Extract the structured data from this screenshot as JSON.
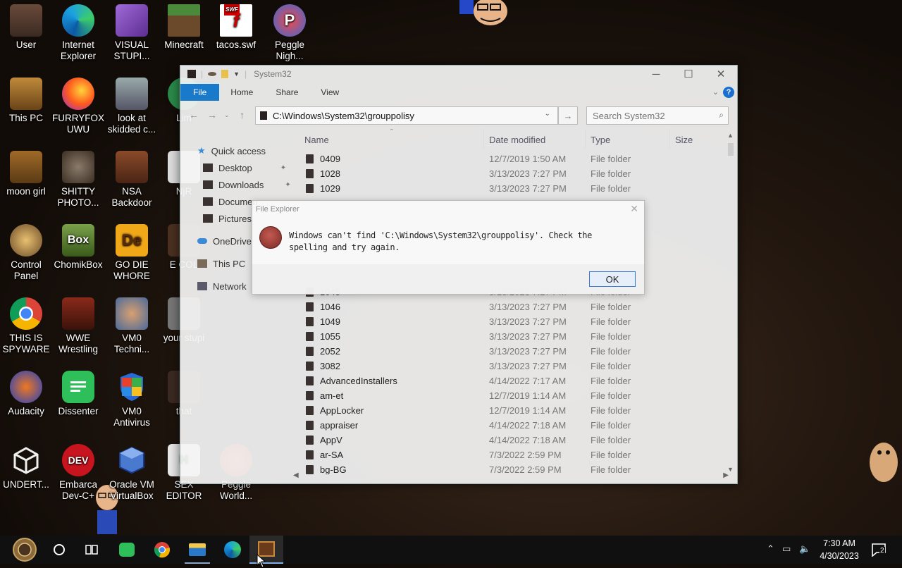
{
  "desktop": {
    "icons": [
      {
        "label": "User"
      },
      {
        "label": "Internet Explorer"
      },
      {
        "label": "VISUAL STUPI..."
      },
      {
        "label": "Minecraft"
      },
      {
        "label": "tacos.swf",
        "badge": "SWF"
      },
      {
        "label": "Peggle Nigh..."
      },
      {
        "label": "This PC"
      },
      {
        "label": "FURRYFOX UWU"
      },
      {
        "label": "look at skidded c..."
      },
      {
        "label": "Lim"
      },
      {
        "label": "moon girl"
      },
      {
        "label": "SHITTY PHOTO..."
      },
      {
        "label": "NSA Backdoor"
      },
      {
        "label": "NjR"
      },
      {
        "label": "Control Panel"
      },
      {
        "label": "ChomikBox",
        "badge": "Box"
      },
      {
        "label": "GO DIE WHORE",
        "badge": "De"
      },
      {
        "label": "E COL"
      },
      {
        "label": "THIS IS SPYWARE"
      },
      {
        "label": "WWE Wrestling"
      },
      {
        "label": "VM0 Techni..."
      },
      {
        "label": "your stupi"
      },
      {
        "label": "Audacity"
      },
      {
        "label": "Dissenter"
      },
      {
        "label": "VM0 Antivirus"
      },
      {
        "label": "that"
      },
      {
        "label": "UNDERT..."
      },
      {
        "label": "Embarca Dev-C+",
        "badge": "DEV"
      },
      {
        "label": "Oracle VM VirtualBox"
      },
      {
        "label": "SEX EDITOR"
      },
      {
        "label": "Peggle World..."
      }
    ]
  },
  "explorer": {
    "title": "System32",
    "ribbon_tabs": [
      "File",
      "Home",
      "Share",
      "View"
    ],
    "help_glyph": "?",
    "address": "C:\\Windows\\System32\\grouppolisy",
    "search_placeholder": "Search System32",
    "nav": {
      "quick_access": "Quick access",
      "desktop": "Desktop",
      "downloads": "Downloads",
      "documents": "Documen",
      "pictures": "Pictures",
      "onedrive": "OneDrive",
      "this_pc": "This PC",
      "network": "Network"
    },
    "columns": {
      "name": "Name",
      "date": "Date modified",
      "type": "Type",
      "size": "Size"
    },
    "rows": [
      {
        "name": "0409",
        "date": "12/7/2019 1:50 AM",
        "type": "File folder"
      },
      {
        "name": "1028",
        "date": "3/13/2023 7:27 PM",
        "type": "File folder"
      },
      {
        "name": "1029",
        "date": "3/13/2023 7:27 PM",
        "type": "File folder"
      },
      {
        "name": "1045",
        "date": "3/13/2023 7:27 PM",
        "type": "File folder"
      },
      {
        "name": "1046",
        "date": "3/13/2023 7:27 PM",
        "type": "File folder"
      },
      {
        "name": "1049",
        "date": "3/13/2023 7:27 PM",
        "type": "File folder"
      },
      {
        "name": "1055",
        "date": "3/13/2023 7:27 PM",
        "type": "File folder"
      },
      {
        "name": "2052",
        "date": "3/13/2023 7:27 PM",
        "type": "File folder"
      },
      {
        "name": "3082",
        "date": "3/13/2023 7:27 PM",
        "type": "File folder"
      },
      {
        "name": "AdvancedInstallers",
        "date": "4/14/2022 7:17 AM",
        "type": "File folder"
      },
      {
        "name": "am-et",
        "date": "12/7/2019 1:14 AM",
        "type": "File folder"
      },
      {
        "name": "AppLocker",
        "date": "12/7/2019 1:14 AM",
        "type": "File folder"
      },
      {
        "name": "appraiser",
        "date": "4/14/2022 7:18 AM",
        "type": "File folder"
      },
      {
        "name": "AppV",
        "date": "4/14/2022 7:18 AM",
        "type": "File folder"
      },
      {
        "name": "ar-SA",
        "date": "7/3/2022 2:59 PM",
        "type": "File folder"
      },
      {
        "name": "bg-BG",
        "date": "7/3/2022 2:59 PM",
        "type": "File folder"
      }
    ]
  },
  "dialog": {
    "title": "File Explorer",
    "message": "Windows can't find 'C:\\Windows\\System32\\grouppolisy'. Check the spelling and try again.",
    "ok_label": "OK"
  },
  "taskbar": {
    "time": "7:30 AM",
    "date": "4/30/2023",
    "notification_count": "2"
  }
}
